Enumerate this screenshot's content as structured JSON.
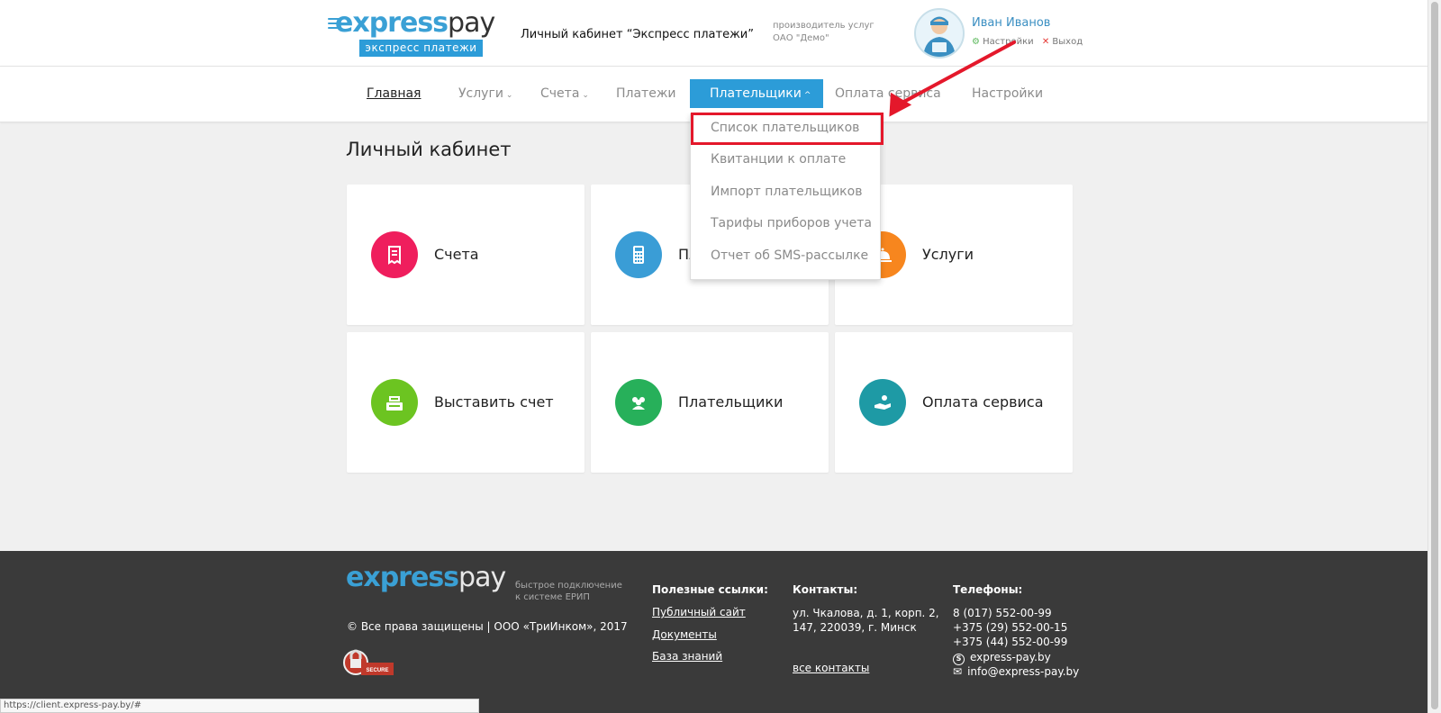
{
  "header": {
    "logo_part1": "express",
    "logo_part2": "pay",
    "logo_tag": "экспресс платежи",
    "title": "Личный кабинет “Экспресс платежи”",
    "provider_label": "производитель услуг",
    "provider_name": "ОАО \"Демо\"",
    "user_name": "Иван Иванов",
    "settings_link": "Настройки",
    "logout_link": "Выход"
  },
  "nav": {
    "home": "Главная",
    "services": "Услуги",
    "accounts": "Счета",
    "payments": "Платежи",
    "payers": "Плательщики",
    "service_payment": "Оплата сервиса",
    "settings": "Настройки"
  },
  "dropdown": {
    "items": [
      "Список плательщиков",
      "Квитанции к оплате",
      "Импорт плательщиков",
      "Тарифы приборов учета",
      "Отчет об SMS-рассылке"
    ]
  },
  "main": {
    "title": "Личный кабинет",
    "cards": [
      {
        "label": "Счета",
        "icon": "invoice-icon",
        "color": "#ef1e5d"
      },
      {
        "label": "Платежи",
        "icon": "pos-terminal-icon",
        "color": "#3a9dd6"
      },
      {
        "label": "Услуги",
        "icon": "service-bell-icon",
        "color": "#f7861e"
      },
      {
        "label": "Выставить счет",
        "icon": "cash-register-icon",
        "color": "#6cc421"
      },
      {
        "label": "Плательщики",
        "icon": "users-icon",
        "color": "#27b05a"
      },
      {
        "label": "Оплата сервиса",
        "icon": "hand-coin-icon",
        "color": "#1e9aa5"
      }
    ]
  },
  "footer": {
    "logo_part1": "express",
    "logo_part2": "pay",
    "tagline_1": "быстрое подключение",
    "tagline_2": "к системе ЕРИП",
    "copyright": "© Все права защищены | ООО «ТриИнком», 2017",
    "badge_text": "COMODO SECURE",
    "links_heading": "Полезные ссылки:",
    "links": [
      "Публичный сайт",
      "Документы",
      "База знаний"
    ],
    "contacts_heading": "Контакты:",
    "address_1": "ул. Чкалова, д. 1, корп. 2,",
    "address_2": "147, 220039, г. Минск",
    "all_contacts": "все контакты",
    "phones_heading": "Телефоны:",
    "phones": [
      "8 (017) 552-00-99",
      "+375 (29) 552-00-15",
      "+375 (44) 552-00-99"
    ],
    "skype": "express-pay.by",
    "email": "info@express-pay.by"
  },
  "statusbar": {
    "url": "https://client.express-pay.by/#"
  },
  "colors": {
    "accent": "#2c9cd8",
    "highlight": "#e4182b",
    "footer_bg": "#3a3a3a"
  }
}
